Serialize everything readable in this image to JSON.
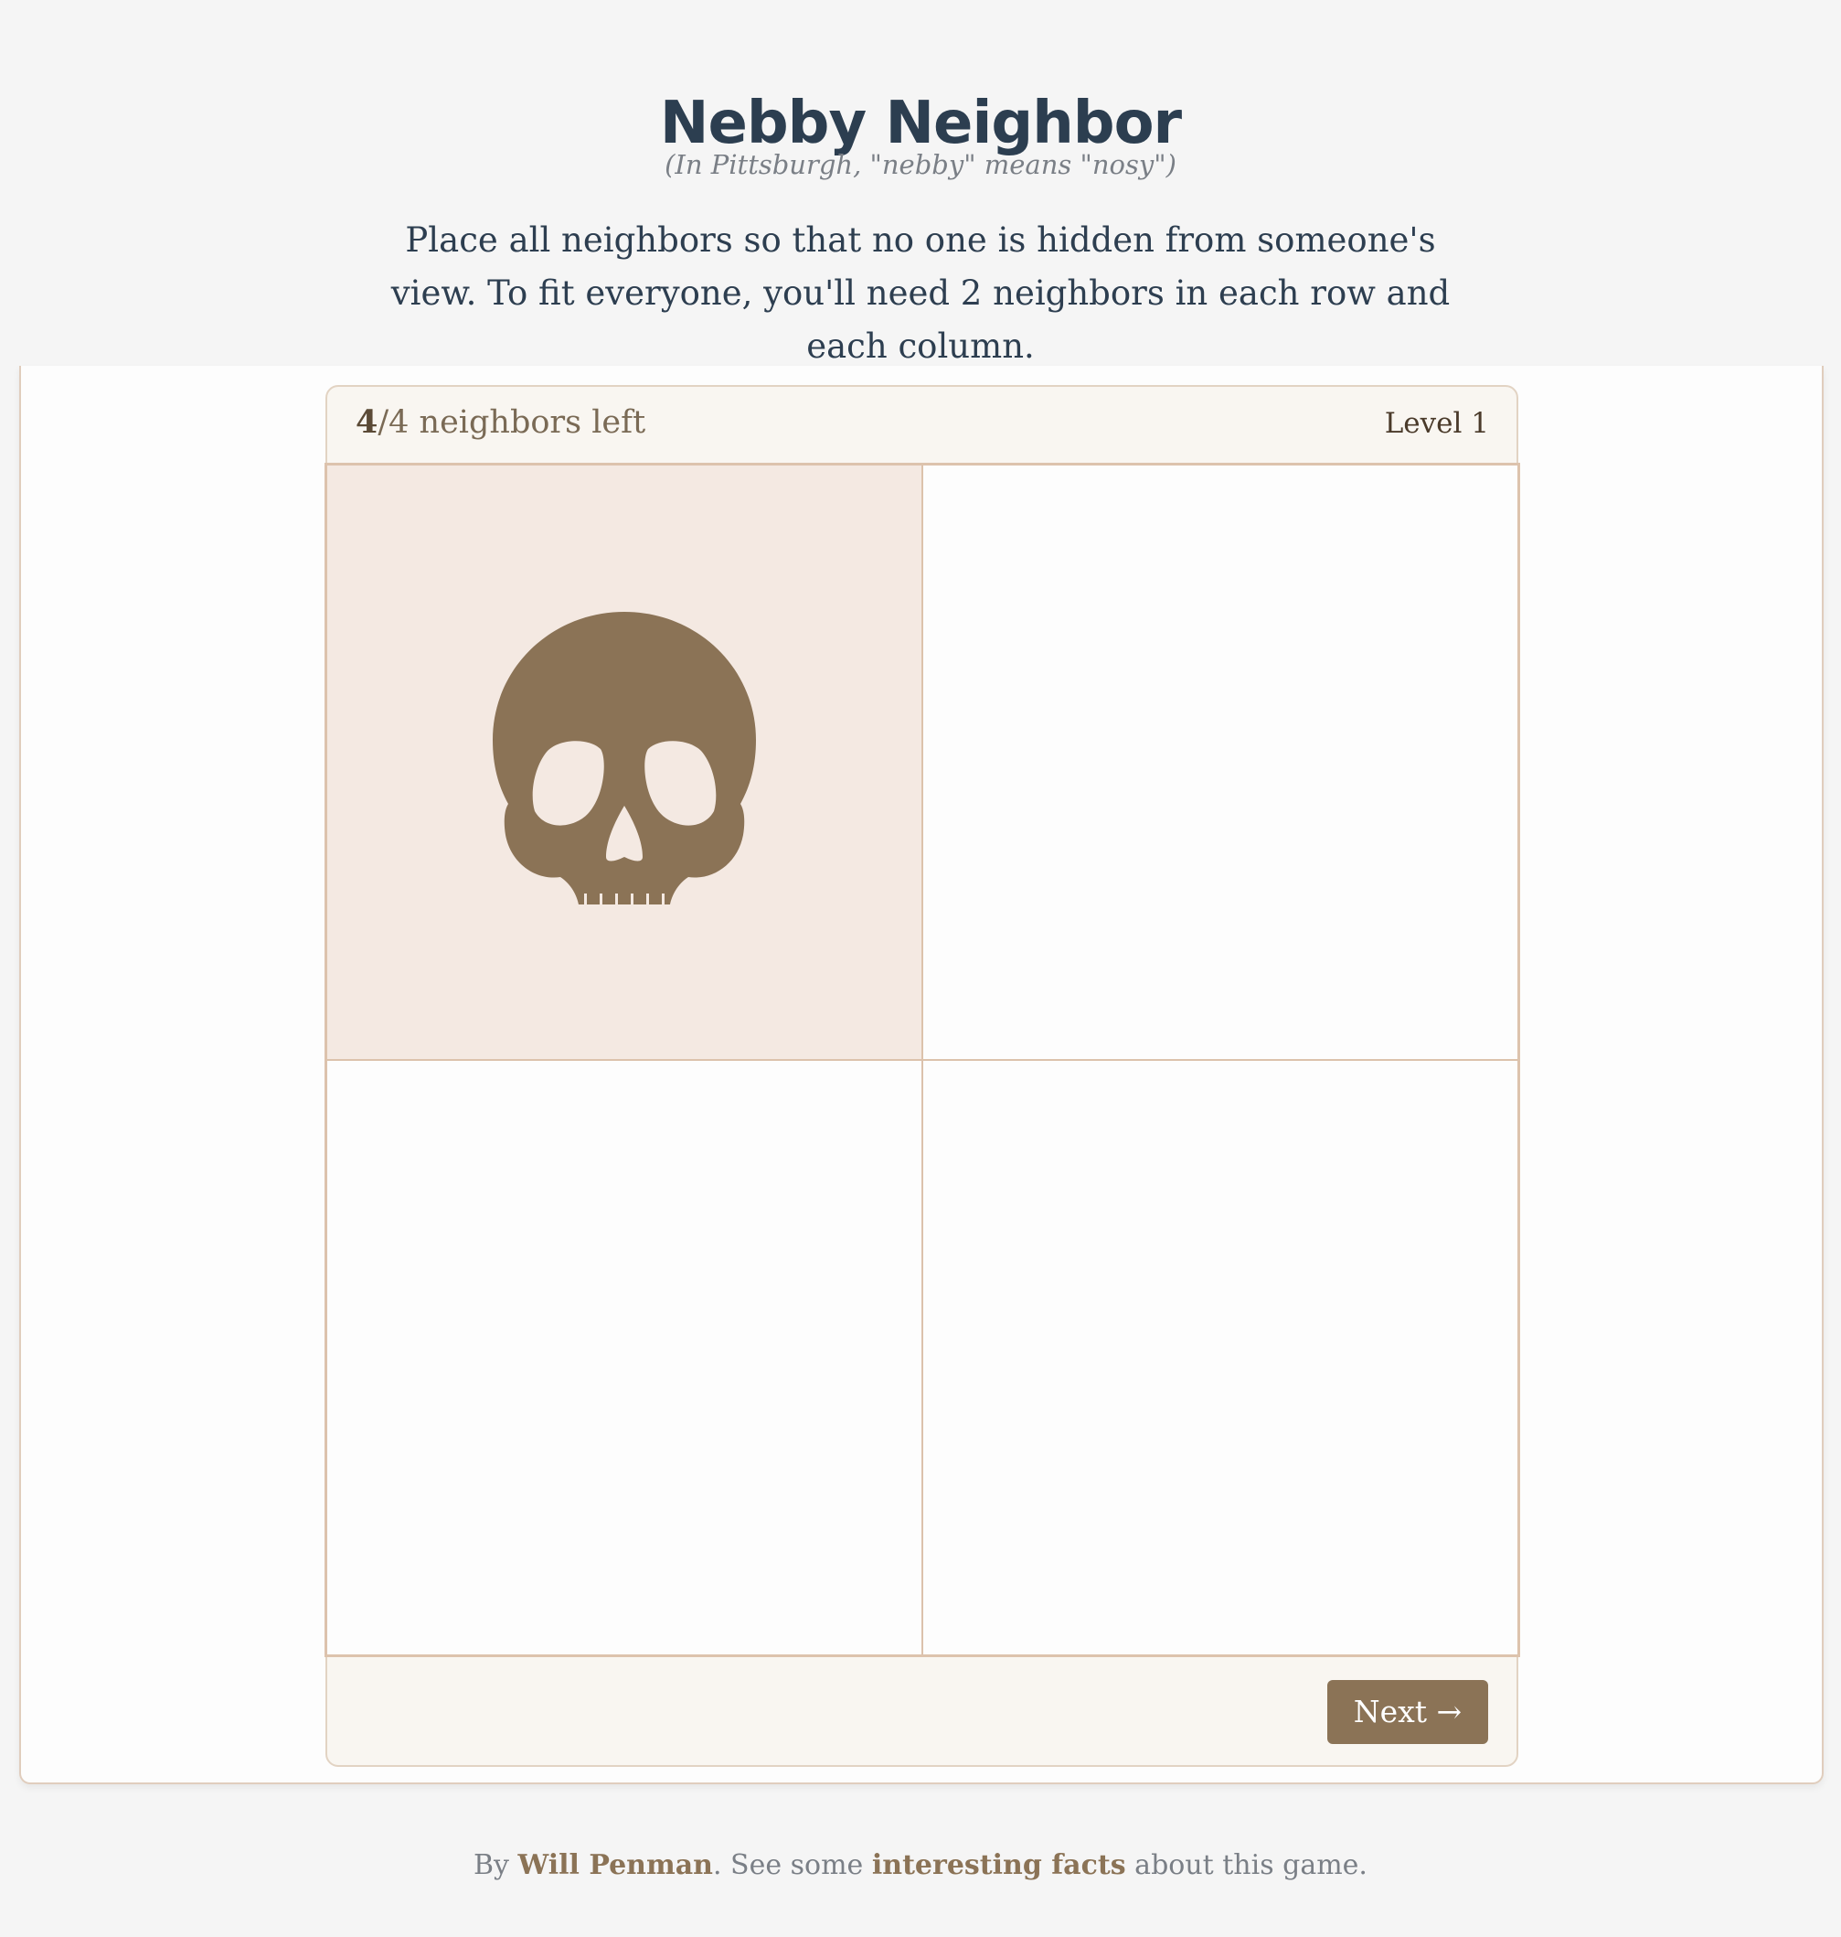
{
  "header": {
    "title": "Nebby Neighbor",
    "subtitle": "(In Pittsburgh, \"nebby\" means \"nosy\")",
    "instructions": "Place all neighbors so that no one is hidden from someone's view. To fit everyone, you'll need 2 neighbors in each row and each column."
  },
  "status": {
    "remaining": "4",
    "total_suffix": "/4 neighbors left",
    "level": "Level 1"
  },
  "board": {
    "rows": 2,
    "cols": 2,
    "cells": [
      {
        "row": 1,
        "col": 1,
        "content": "skull-icon",
        "highlighted": true
      },
      {
        "row": 1,
        "col": 2,
        "content": "",
        "highlighted": false
      },
      {
        "row": 2,
        "col": 1,
        "content": "",
        "highlighted": false
      },
      {
        "row": 2,
        "col": 2,
        "content": "",
        "highlighted": false
      }
    ]
  },
  "controls": {
    "next_label": "Next →"
  },
  "footer": {
    "prefix": "By ",
    "author": "Will Penman",
    "middle": ". See some ",
    "facts_link": "interesting facts",
    "suffix": " about this game."
  },
  "colors": {
    "accent": "#8b7356",
    "title": "#2c3e50",
    "highlight_cell": "#f4e9e2",
    "grid_line": "#dcc2ac"
  }
}
